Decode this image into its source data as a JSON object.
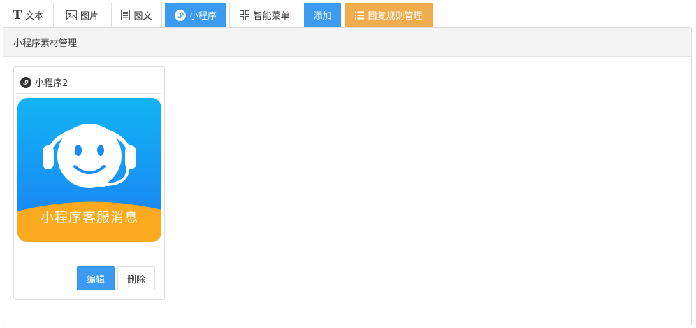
{
  "tabs": [
    {
      "label": "文本",
      "icon": "text-icon"
    },
    {
      "label": "图片",
      "icon": "image-icon"
    },
    {
      "label": "图文",
      "icon": "article-icon"
    },
    {
      "label": "小程序",
      "icon": "miniprogram-icon",
      "active": true
    },
    {
      "label": "智能菜单",
      "icon": "menu-grid-icon"
    }
  ],
  "toolbar": {
    "add_label": "添加",
    "rules_label": "回复规则管理"
  },
  "panel": {
    "title": "小程序素材管理"
  },
  "card": {
    "title": "小程序2",
    "image_caption": "小程序客服消息",
    "edit_label": "编辑",
    "delete_label": "删除"
  },
  "colors": {
    "primary": "#3a9bf0",
    "warning": "#f0ad4e",
    "thumb_blue": "#1a90f5",
    "thumb_orange": "#fbaa1f"
  }
}
